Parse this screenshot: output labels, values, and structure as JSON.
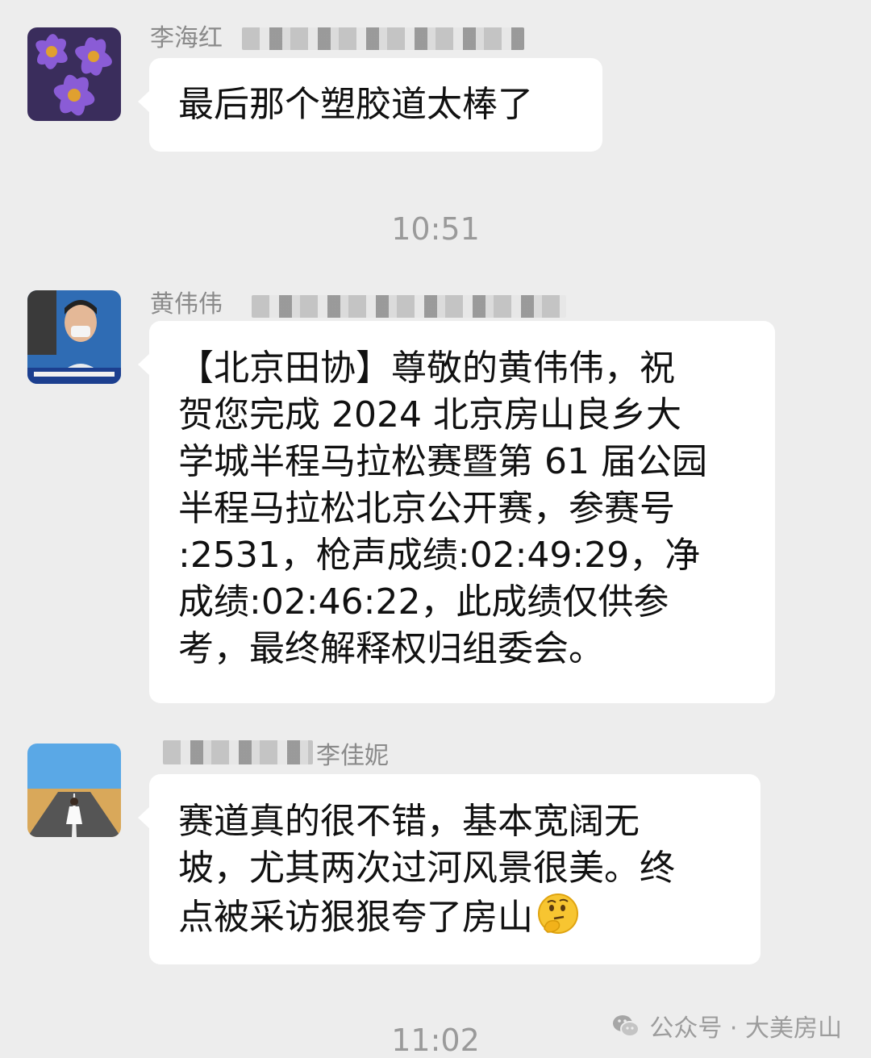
{
  "messages": [
    {
      "sender": "李海红",
      "lines": [
        "最后那个塑胶道太棒了"
      ]
    },
    {
      "sender": "黄伟伟",
      "lines": [
        "【北京田协】尊敬的黄伟伟，祝",
        "贺您完成 2024 北京房山良乡大",
        "学城半程马拉松赛暨第 61 届公园",
        "半程马拉松北京公开赛，参赛号",
        ":2531，枪声成绩:02:49:29，净",
        "成绩:02:46:22，此成绩仅供参",
        "考，最终解释权归组委会。"
      ]
    },
    {
      "sender": "李佳妮",
      "lines": [
        "赛道真的很不错，基本宽阔无",
        "坡，尤其两次过河风景很美。终",
        "点被采访狠狠夸了房山"
      ],
      "trailing_emoji": "thinking-face-emoji"
    }
  ],
  "timestamps": [
    "10:51",
    "11:02"
  ],
  "watermark": {
    "text": "公众号 · 大美房山",
    "icon": "wechat-icon"
  },
  "colors": {
    "background": "#ededed",
    "bubble": "#ffffff",
    "meta_text": "#9a9a9a"
  }
}
